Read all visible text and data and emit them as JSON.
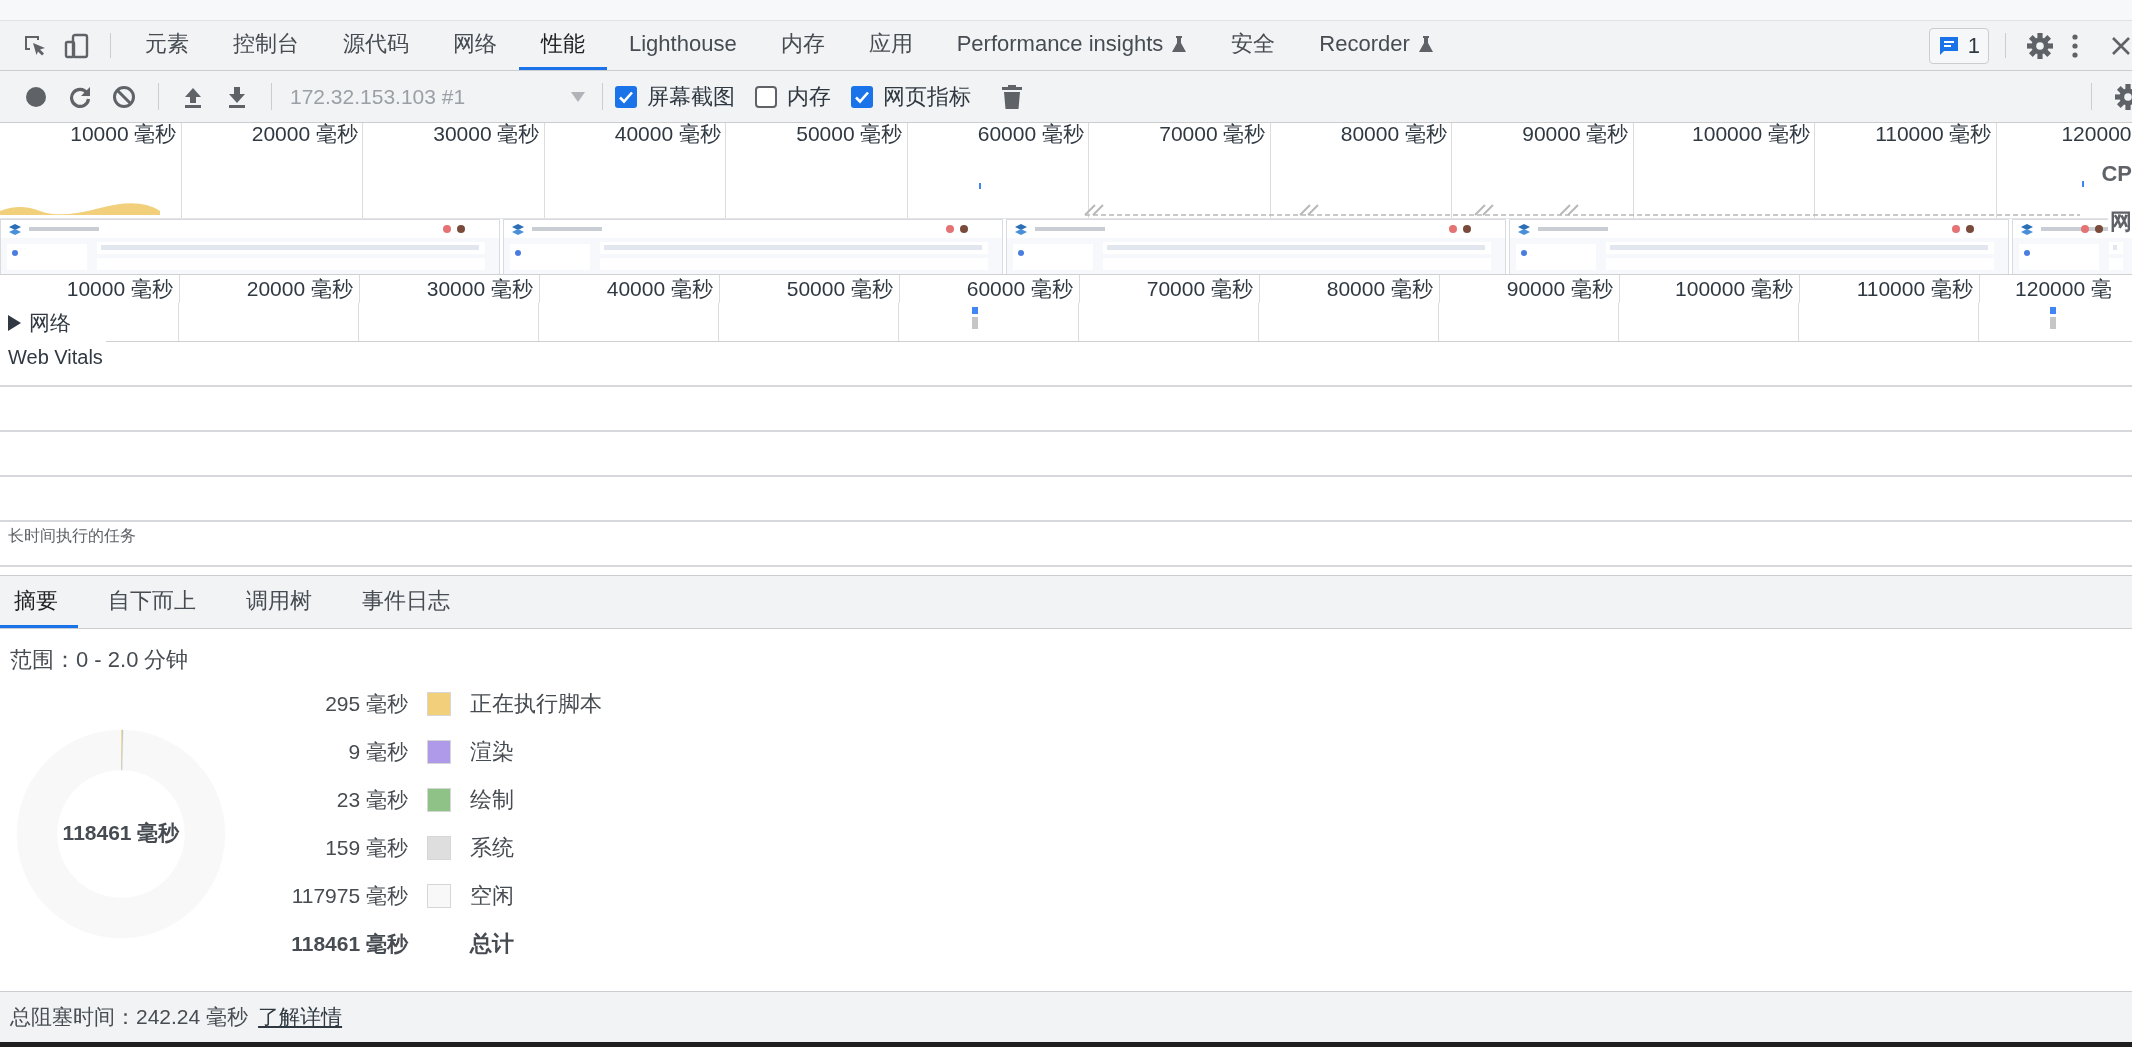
{
  "tabs": [
    {
      "label": "元素",
      "selected": false
    },
    {
      "label": "控制台",
      "selected": false
    },
    {
      "label": "源代码",
      "selected": false
    },
    {
      "label": "网络",
      "selected": false
    },
    {
      "label": "性能",
      "selected": true
    },
    {
      "label": "Lighthouse",
      "selected": false
    },
    {
      "label": "内存",
      "selected": false
    },
    {
      "label": "应用",
      "selected": false
    },
    {
      "label": "Performance insights",
      "selected": false,
      "experimental": true
    },
    {
      "label": "安全",
      "selected": false
    },
    {
      "label": "Recorder",
      "selected": false,
      "experimental": true
    }
  ],
  "issues_badge": {
    "count": "1"
  },
  "toolbar": {
    "target": {
      "value": "172.32.153.103 #1",
      "disabled": true
    },
    "options": [
      {
        "label": "屏幕截图",
        "checked": true
      },
      {
        "label": "内存",
        "checked": false
      },
      {
        "label": "网页指标",
        "checked": true
      }
    ]
  },
  "overview": {
    "ticks": [
      "10000 毫秒",
      "20000 毫秒",
      "30000 毫秒",
      "40000 毫秒",
      "50000 毫秒",
      "60000 毫秒",
      "70000 毫秒",
      "80000 毫秒",
      "90000 毫秒",
      "100000 毫秒",
      "110000 毫秒",
      "120000"
    ],
    "side_labels": [
      "CP",
      "网"
    ]
  },
  "timeline": {
    "ticks": [
      "10000 毫秒",
      "20000 毫秒",
      "30000 毫秒",
      "40000 毫秒",
      "50000 毫秒",
      "60000 毫秒",
      "70000 毫秒",
      "80000 毫秒",
      "90000 毫秒",
      "100000 毫秒",
      "110000 毫秒",
      "120000 毫"
    ],
    "network": {
      "label": "网络",
      "expanded": false
    },
    "web_vitals": {
      "title": "Web Vitals",
      "long_tasks": "长时间执行的任务"
    }
  },
  "details_tabs": [
    {
      "label": "摘要",
      "selected": true
    },
    {
      "label": "自下而上",
      "selected": false
    },
    {
      "label": "调用树",
      "selected": false
    },
    {
      "label": "事件日志",
      "selected": false
    }
  ],
  "summary": {
    "range": "范围：0 - 2.0 分钟",
    "center": "118461 毫秒",
    "legend": [
      {
        "value": "295 毫秒",
        "label": "正在执行脚本",
        "color": "#f2cf7b"
      },
      {
        "value": "9 毫秒",
        "label": "渲染",
        "color": "#af9ae9"
      },
      {
        "value": "23 毫秒",
        "label": "绘制",
        "color": "#8fc286"
      },
      {
        "value": "159 毫秒",
        "label": "系统",
        "color": "#dedede"
      },
      {
        "value": "117975 毫秒",
        "label": "空闲",
        "color": "#f8f8f8"
      }
    ],
    "total": {
      "value": "118461 毫秒",
      "label": "总计"
    }
  },
  "footer": {
    "text": "总阻塞时间：242.24 毫秒",
    "link": "了解详情"
  }
}
